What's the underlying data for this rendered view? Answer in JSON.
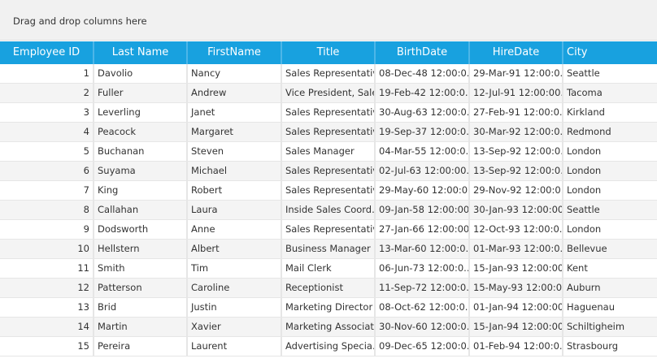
{
  "group_panel": {
    "text": "Drag and drop columns here"
  },
  "columns": [
    "Employee ID",
    "Last Name",
    "FirstName",
    "Title",
    "BirthDate",
    "HireDate",
    "City"
  ],
  "rows": [
    [
      "1",
      "Davolio",
      "Nancy",
      "Sales Representative",
      "08-Dec-48 12:00:0...",
      "29-Mar-91 12:00:0...",
      "Seattle"
    ],
    [
      "2",
      "Fuller",
      "Andrew",
      "Vice President, Sales",
      "19-Feb-42 12:00:0...",
      "12-Jul-91 12:00:00...",
      "Tacoma"
    ],
    [
      "3",
      "Leverling",
      "Janet",
      "Sales Representative",
      "30-Aug-63 12:00:0...",
      "27-Feb-91 12:00:0...",
      "Kirkland"
    ],
    [
      "4",
      "Peacock",
      "Margaret",
      "Sales Representative",
      "19-Sep-37 12:00:0...",
      "30-Mar-92 12:00:0...",
      "Redmond"
    ],
    [
      "5",
      "Buchanan",
      "Steven",
      "Sales Manager",
      "04-Mar-55 12:00:0...",
      "13-Sep-92 12:00:0...",
      "London"
    ],
    [
      "6",
      "Suyama",
      "Michael",
      "Sales Representative",
      "02-Jul-63 12:00:00...",
      "13-Sep-92 12:00:0...",
      "London"
    ],
    [
      "7",
      "King",
      "Robert",
      "Sales Representative",
      "29-May-60 12:00:0...",
      "29-Nov-92 12:00:0...",
      "London"
    ],
    [
      "8",
      "Callahan",
      "Laura",
      "Inside Sales Coord...",
      "09-Jan-58 12:00:00...",
      "30-Jan-93 12:00:00...",
      "Seattle"
    ],
    [
      "9",
      "Dodsworth",
      "Anne",
      "Sales Representative",
      "27-Jan-66 12:00:00...",
      "12-Oct-93 12:00:0...",
      "London"
    ],
    [
      "10",
      "Hellstern",
      "Albert",
      "Business Manager",
      "13-Mar-60 12:00:0...",
      "01-Mar-93 12:00:0...",
      "Bellevue"
    ],
    [
      "11",
      "Smith",
      "Tim",
      "Mail Clerk",
      "06-Jun-73 12:00:0...",
      "15-Jan-93 12:00:00...",
      "Kent"
    ],
    [
      "12",
      "Patterson",
      "Caroline",
      "Receptionist",
      "11-Sep-72 12:00:0...",
      "15-May-93 12:00:0...",
      "Auburn"
    ],
    [
      "13",
      "Brid",
      "Justin",
      "Marketing Director",
      "08-Oct-62 12:00:0...",
      "01-Jan-94 12:00:00...",
      "Haguenau"
    ],
    [
      "14",
      "Martin",
      "Xavier",
      "Marketing Associate",
      "30-Nov-60 12:00:0...",
      "15-Jan-94 12:00:00...",
      "Schiltigheim"
    ],
    [
      "15",
      "Pereira",
      "Laurent",
      "Advertising Specia...",
      "09-Dec-65 12:00:0...",
      "01-Feb-94 12:00:0...",
      "Strasbourg"
    ]
  ]
}
